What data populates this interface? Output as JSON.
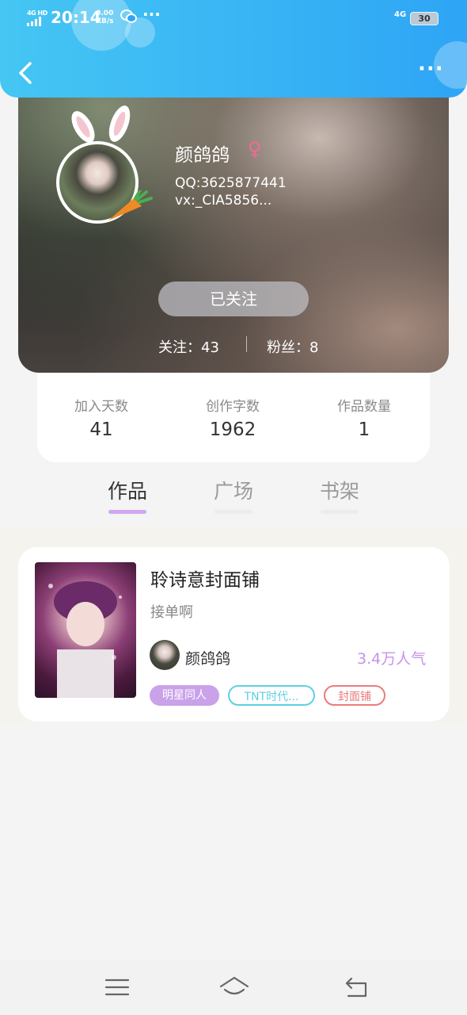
{
  "status_bar": {
    "signal_label": "4G HD",
    "time": "20:14",
    "net_speed_value": "0.00",
    "net_speed_unit": "KB/s",
    "wechat_icon": "wechat-icon",
    "more_dots": "···",
    "network_right": "4G",
    "battery": "30"
  },
  "header": {
    "back_icon": "chevron-left-icon",
    "more_icon": "more-dots-icon",
    "more_label": "···",
    "accent_color": "#2ea5f5"
  },
  "profile": {
    "name": "颜鸽鸽",
    "gender_symbol": "♀",
    "qq": "QQ:3625877441",
    "vx": "vx:_CIA5856...",
    "follow_button": "已关注",
    "following": "关注：43",
    "fans": "粉丝：8"
  },
  "stats": [
    {
      "label": "加入天数",
      "value": "41"
    },
    {
      "label": "创作字数",
      "value": "1962"
    },
    {
      "label": "作品数量",
      "value": "1"
    }
  ],
  "tabs": [
    {
      "label": "作品",
      "active": true
    },
    {
      "label": "广场",
      "active": false
    },
    {
      "label": "书架",
      "active": false
    }
  ],
  "work": {
    "title": "聆诗意封面铺",
    "description": "接单啊",
    "author": "颜鸽鸽",
    "popularity": "3.4万人气",
    "tags": [
      {
        "label": "明星同人",
        "style": "filled",
        "color": "#c9a2ea"
      },
      {
        "label": "TNT时代...",
        "style": "outline",
        "color": "#5fcfe6"
      },
      {
        "label": "封面铺",
        "style": "outline",
        "color": "#e97b7b"
      }
    ]
  },
  "navbar": {
    "menu_icon": "menu-icon",
    "home_icon": "home-icon",
    "back_icon": "back-icon"
  }
}
